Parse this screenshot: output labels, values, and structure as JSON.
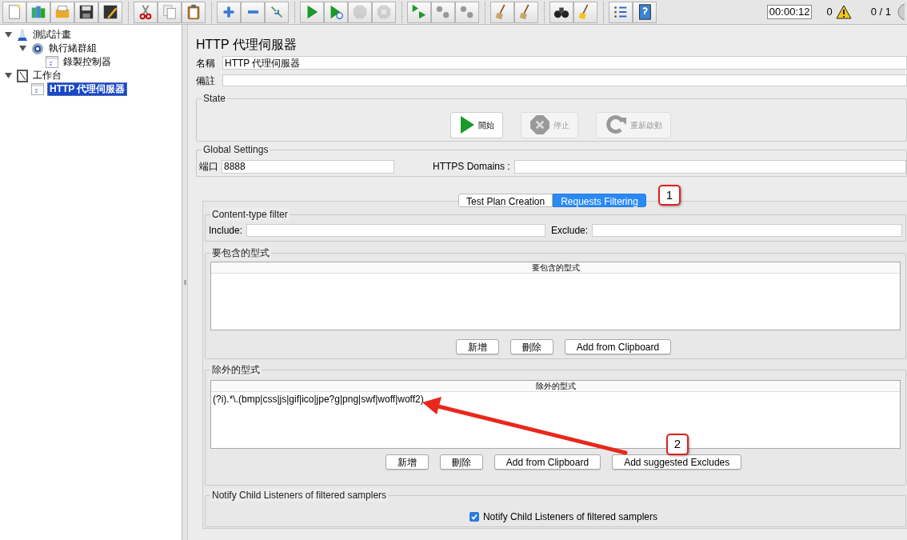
{
  "toolbar": {
    "groups": [
      [
        {
          "kind": "new",
          "disabled": false
        },
        {
          "kind": "templates",
          "disabled": false
        },
        {
          "kind": "open",
          "disabled": false
        },
        {
          "kind": "save",
          "disabled": false
        },
        {
          "kind": "save-as",
          "disabled": false
        }
      ],
      [
        {
          "kind": "cut",
          "disabled": false
        },
        {
          "kind": "copy",
          "disabled": false
        },
        {
          "kind": "paste",
          "disabled": false
        }
      ],
      [
        {
          "kind": "expand",
          "disabled": false
        },
        {
          "kind": "collapse",
          "disabled": false
        },
        {
          "kind": "toggle",
          "disabled": false
        }
      ],
      [
        {
          "kind": "start",
          "disabled": false
        },
        {
          "kind": "start-no-timers",
          "disabled": false
        },
        {
          "kind": "stop",
          "disabled": true
        },
        {
          "kind": "shutdown",
          "disabled": true
        }
      ],
      [
        {
          "kind": "remote-start",
          "disabled": false
        },
        {
          "kind": "remote-stop",
          "disabled": false
        },
        {
          "kind": "remote-exit",
          "disabled": false
        }
      ],
      [
        {
          "kind": "clear",
          "disabled": false
        },
        {
          "kind": "clear-all",
          "disabled": false
        }
      ],
      [
        {
          "kind": "search",
          "disabled": false
        },
        {
          "kind": "reset",
          "disabled": false
        }
      ],
      [
        {
          "kind": "functions",
          "disabled": false
        },
        {
          "kind": "help",
          "disabled": false
        }
      ]
    ],
    "timer": "00:00:12",
    "warnings": "0",
    "threads": "0 / 1"
  },
  "tree": [
    {
      "label": "測試計畫",
      "kind": "plan",
      "selected": false,
      "expanded": true,
      "children": [
        {
          "label": "執行緒群組",
          "kind": "thread-group",
          "selected": false,
          "expanded": true,
          "children": [
            {
              "label": "錄製控制器",
              "kind": "controller",
              "selected": false
            }
          ]
        }
      ]
    },
    {
      "label": "工作台",
      "kind": "workbench",
      "selected": false,
      "expanded": true,
      "children": [
        {
          "label": "HTTP 代理伺服器",
          "kind": "controller",
          "selected": true
        }
      ]
    }
  ],
  "panel": {
    "title": "HTTP 代理伺服器",
    "name_label": "名稱",
    "name_value": "HTTP 代理伺服器",
    "comment_label": "備註",
    "state": {
      "title": "State",
      "buttons": [
        {
          "label": "開始",
          "kind": "start",
          "disabled": false
        },
        {
          "label": "停止",
          "kind": "stop",
          "disabled": true
        },
        {
          "label": "重新啟動",
          "kind": "restart",
          "disabled": true
        }
      ]
    },
    "global_settings": {
      "title": "Global Settings",
      "port_label": "端口",
      "port_value": "8888",
      "https_label": "HTTPS Domains :"
    },
    "tabs": [
      {
        "label": "Test Plan Creation",
        "selected": false
      },
      {
        "label": "Requests Filtering",
        "selected": true
      }
    ],
    "content_type_filter": {
      "title": "Content-type filter",
      "include_label": "Include:",
      "exclude_label": "Exclude:"
    },
    "include_patterns": {
      "title": "要包含的型式",
      "column": "要包含的型式",
      "buttons": [
        "新增",
        "刪除",
        "Add from Clipboard"
      ]
    },
    "exclude_patterns": {
      "title": "除外的型式",
      "column": "除外的型式",
      "rows": [
        "(?i).*\\.(bmp|css|js|gif|ico|jpe?g|png|swf|woff|woff2)"
      ],
      "buttons": [
        "新增",
        "刪除",
        "Add from Clipboard",
        "Add suggested Excludes"
      ]
    },
    "notify": {
      "title": "Notify Child Listeners of filtered samplers",
      "checkbox_label": "Notify Child Listeners of filtered samplers",
      "checked": true
    }
  },
  "annotations": [
    {
      "label": "1"
    },
    {
      "label": "2"
    }
  ]
}
